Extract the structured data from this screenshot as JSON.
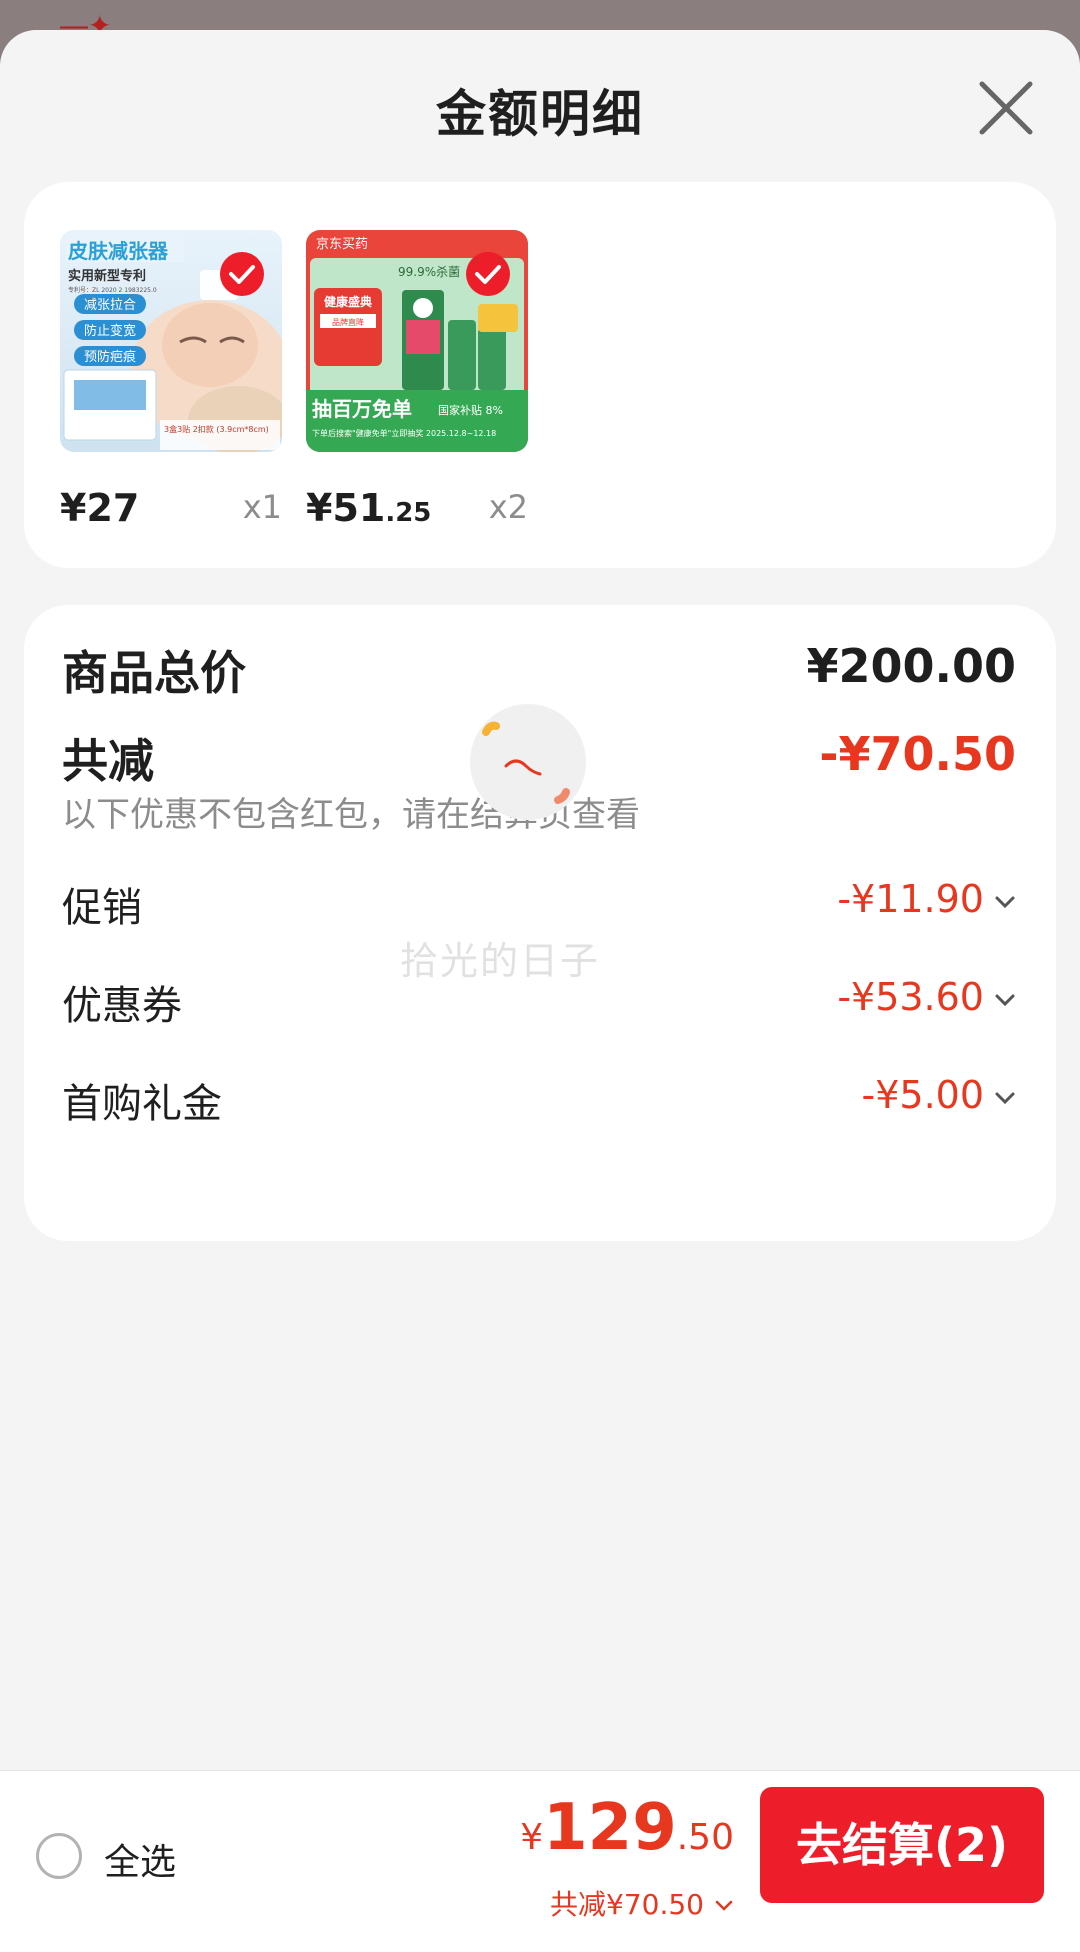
{
  "sheet": {
    "title": "金额明细"
  },
  "products": [
    {
      "price_symbol": "¥",
      "price_int": "27",
      "price_dec": "",
      "qty": "x1",
      "thumb": {
        "headline": "皮肤减张器",
        "subline": "实用新型专利",
        "tags": [
          "减张拉合",
          "防止变宽",
          "预防疤痕"
        ],
        "footer": "3盒3贴 2扣款 (3.9cm*8cm)"
      }
    },
    {
      "price_symbol": "¥",
      "price_int": "51",
      "price_dec": ".25",
      "qty": "x2",
      "thumb": {
        "store": "京东买药",
        "claim": "99.9%杀菌",
        "badge": "健康盛典",
        "badge_sub": "品牌直降",
        "banner": "抽百万免单",
        "subsidy": "国家补贴 8%",
        "footer": "下单后搜索\"健康免单\"立即抽奖 2025.12.8~12.18"
      }
    }
  ],
  "summary": {
    "total_label": "商品总价",
    "total_value": "¥200.00",
    "reduce_label": "共减",
    "reduce_value": "-¥70.50",
    "note": "以下优惠不包含红包，请在结算页查看",
    "items": [
      {
        "label": "促销",
        "value": "-¥11.90"
      },
      {
        "label": "优惠券",
        "value": "-¥53.60"
      },
      {
        "label": "首购礼金",
        "value": "-¥5.00"
      }
    ]
  },
  "watermark": "拾光的日子",
  "bottom": {
    "select_all": "全选",
    "price_symbol": "¥",
    "price_int": "129",
    "price_dec": ".50",
    "saved": "共减¥70.50",
    "checkout": "去结算(2)"
  },
  "colors": {
    "accent_red": "#e8371f",
    "button_red": "#ee1d2a",
    "background": "#f4f4f4"
  }
}
